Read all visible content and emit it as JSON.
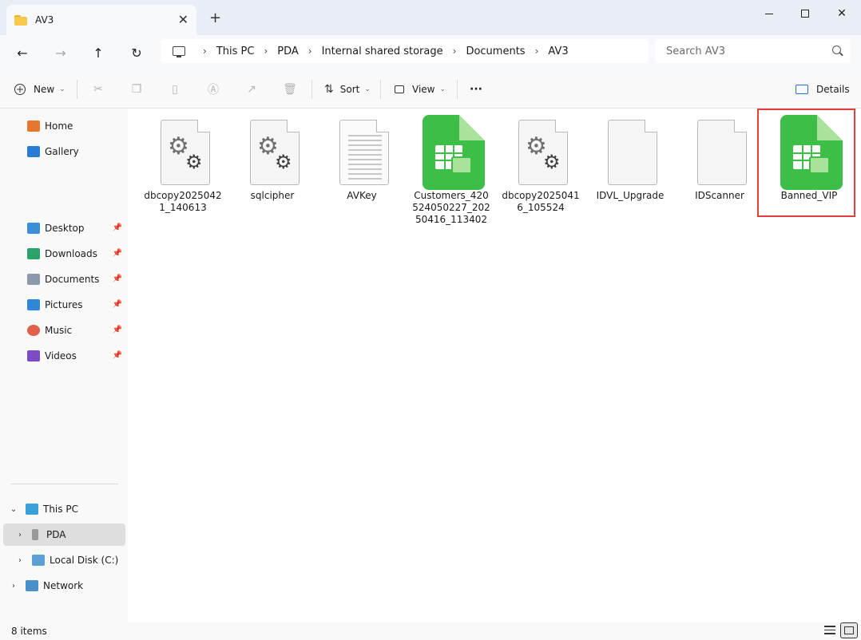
{
  "window": {
    "tab_title": "AV3",
    "tab_close": "✕",
    "new_tab": "+",
    "close": "✕"
  },
  "nav": {
    "back": "←",
    "forward": "→",
    "up": "↑",
    "refresh": "↻",
    "breadcrumb": [
      "This PC",
      "PDA",
      "Internal shared storage",
      "Documents",
      "AV3"
    ],
    "separator": "›",
    "search_placeholder": "Search AV3"
  },
  "toolbar": {
    "new_label": "New",
    "sort_label": "Sort",
    "view_label": "View",
    "more_label": "···",
    "details_label": "Details",
    "chevron": "⌄"
  },
  "sidebar": {
    "quick": [
      {
        "label": "Home",
        "color": "#e8772e"
      },
      {
        "label": "Gallery",
        "color": "#2b7bd6"
      }
    ],
    "pinned": [
      {
        "label": "Desktop",
        "color": "#3a8fd8"
      },
      {
        "label": "Downloads",
        "color": "#2aa26a"
      },
      {
        "label": "Documents",
        "color": "#8a9aab"
      },
      {
        "label": "Pictures",
        "color": "#2f87dc"
      },
      {
        "label": "Music",
        "color": "#e0604a"
      },
      {
        "label": "Videos",
        "color": "#7c4bc8"
      }
    ],
    "tree": [
      {
        "label": "This PC",
        "expander": "⌄",
        "color": "#3aa0d8"
      },
      {
        "label": "PDA",
        "expander": "›",
        "color": "#9a9a9a"
      },
      {
        "label": "Local Disk (C:)",
        "expander": "›",
        "color": "#5aa0d0"
      },
      {
        "label": "Network",
        "expander": "›",
        "color": "#4a90c8"
      }
    ],
    "pin_glyph": "📌"
  },
  "files": [
    {
      "name": "dbcopy20250421_140613",
      "icon": "settings-file-icon"
    },
    {
      "name": "sqlcipher",
      "icon": "settings-file-icon"
    },
    {
      "name": "AVKey",
      "icon": "text-file-icon"
    },
    {
      "name": "Customers_420524050227_20250416_113402",
      "icon": "spreadsheet-icon"
    },
    {
      "name": "dbcopy20250416_105524",
      "icon": "settings-file-icon"
    },
    {
      "name": "IDVL_Upgrade",
      "icon": "blank-file-icon"
    },
    {
      "name": "IDScanner",
      "icon": "blank-file-icon"
    },
    {
      "name": "Banned_VIP",
      "icon": "spreadsheet-icon"
    }
  ],
  "status": {
    "item_count": "8 items"
  }
}
